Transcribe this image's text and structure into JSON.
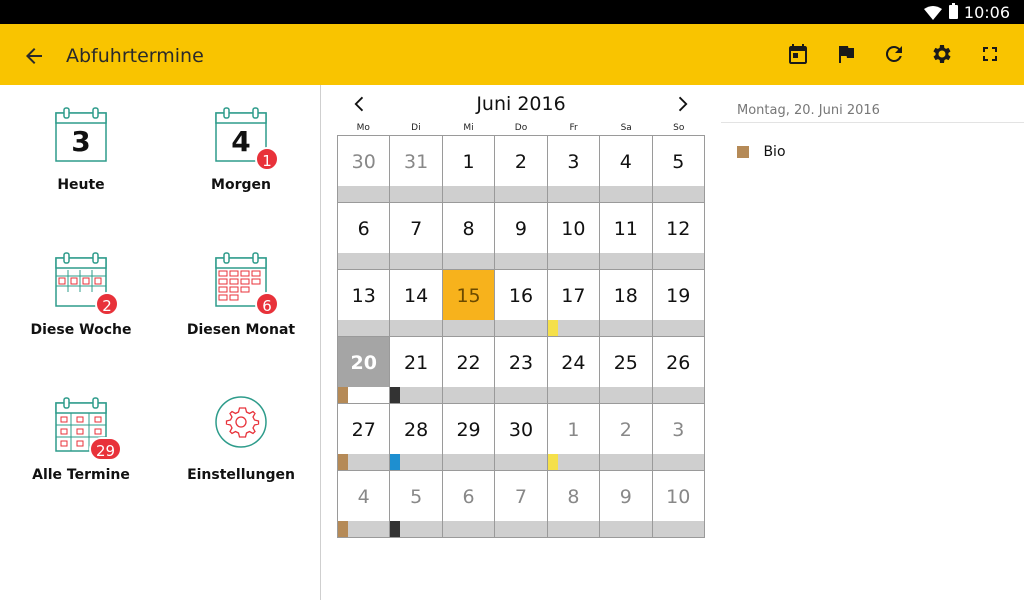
{
  "status": {
    "time": "10:06",
    "wifi_icon": "wifi-icon",
    "battery_icon": "battery-icon"
  },
  "appbar": {
    "title": "Abfuhrtermine",
    "back_icon": "arrow-left-icon",
    "actions": [
      "calendar-today-icon",
      "flag-icon",
      "refresh-icon",
      "gear-icon",
      "fullscreen-icon"
    ],
    "color": "#f9c400"
  },
  "tiles": [
    {
      "label": "Heute",
      "icon_number": "3",
      "badge": ""
    },
    {
      "label": "Morgen",
      "icon_number": "4",
      "badge": "1"
    },
    {
      "label": "Diese Woche",
      "badge": "2"
    },
    {
      "label": "Diesen Monat",
      "badge": "6"
    },
    {
      "label": "Alle Termine",
      "badge": "29"
    },
    {
      "label": "Einstellungen",
      "badge": ""
    }
  ],
  "calendar": {
    "month_label": "Juni 2016",
    "weekdays": [
      "Mo",
      "Di",
      "Mi",
      "Do",
      "Fr",
      "Sa",
      "So"
    ],
    "weeks": [
      [
        {
          "d": "30",
          "o": true
        },
        {
          "d": "31",
          "o": true
        },
        {
          "d": "1"
        },
        {
          "d": "2"
        },
        {
          "d": "3"
        },
        {
          "d": "4"
        },
        {
          "d": "5"
        }
      ],
      [
        {
          "d": "6"
        },
        {
          "d": "7"
        },
        {
          "d": "8"
        },
        {
          "d": "9"
        },
        {
          "d": "10"
        },
        {
          "d": "11"
        },
        {
          "d": "12"
        }
      ],
      [
        {
          "d": "13"
        },
        {
          "d": "14"
        },
        {
          "d": "15",
          "today": true
        },
        {
          "d": "16"
        },
        {
          "d": "17",
          "m": "#f5e04a"
        },
        {
          "d": "18"
        },
        {
          "d": "19"
        }
      ],
      [
        {
          "d": "20",
          "sel": true,
          "m": "#b58a57"
        },
        {
          "d": "21",
          "m": "#333333"
        },
        {
          "d": "22"
        },
        {
          "d": "23"
        },
        {
          "d": "24"
        },
        {
          "d": "25"
        },
        {
          "d": "26"
        }
      ],
      [
        {
          "d": "27",
          "m": "#b58a57"
        },
        {
          "d": "28",
          "m": "#1e8fd0"
        },
        {
          "d": "29"
        },
        {
          "d": "30"
        },
        {
          "d": "1",
          "o": true,
          "m": "#f5e04a"
        },
        {
          "d": "2",
          "o": true
        },
        {
          "d": "3",
          "o": true
        }
      ],
      [
        {
          "d": "4",
          "o": true,
          "m": "#b58a57"
        },
        {
          "d": "5",
          "o": true,
          "m": "#333333"
        },
        {
          "d": "6",
          "o": true
        },
        {
          "d": "7",
          "o": true
        },
        {
          "d": "8",
          "o": true
        },
        {
          "d": "9",
          "o": true
        },
        {
          "d": "10",
          "o": true
        }
      ]
    ],
    "today_color": "#f7b21c",
    "selected_color": "#a5a5a5"
  },
  "detail": {
    "date": "Montag, 20. Juni 2016",
    "entries": [
      {
        "label": "Bio",
        "color": "#b58a57"
      }
    ]
  }
}
